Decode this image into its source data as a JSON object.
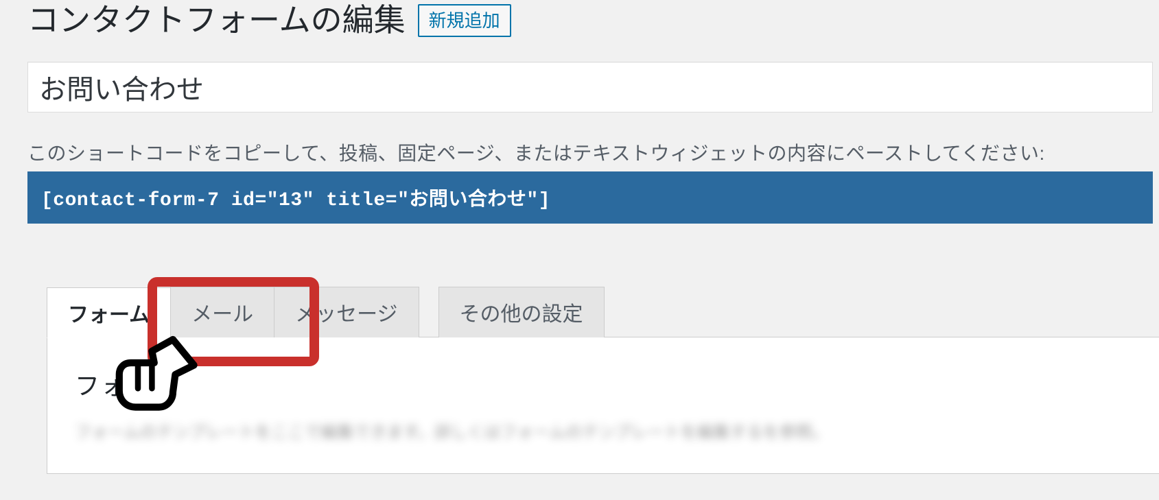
{
  "header": {
    "title": "コンタクトフォームの編集",
    "add_new_label": "新規追加"
  },
  "form": {
    "title_value": "お問い合わせ"
  },
  "shortcode": {
    "label": "このショートコードをコピーして、投稿、固定ページ、またはテキストウィジェットの内容にペーストしてください:",
    "value": "[contact-form-7 id=\"13\" title=\"お問い合わせ\"]"
  },
  "tabs": {
    "items": [
      {
        "label": "フォーム"
      },
      {
        "label": "メール"
      },
      {
        "label": "メッセージ"
      },
      {
        "label": "その他の設定"
      }
    ],
    "content_title": "フォーム",
    "content_desc": "フォームのテンプレートをここで編集できます。詳しくはフォームのテンプレートを編集するを参照。"
  }
}
